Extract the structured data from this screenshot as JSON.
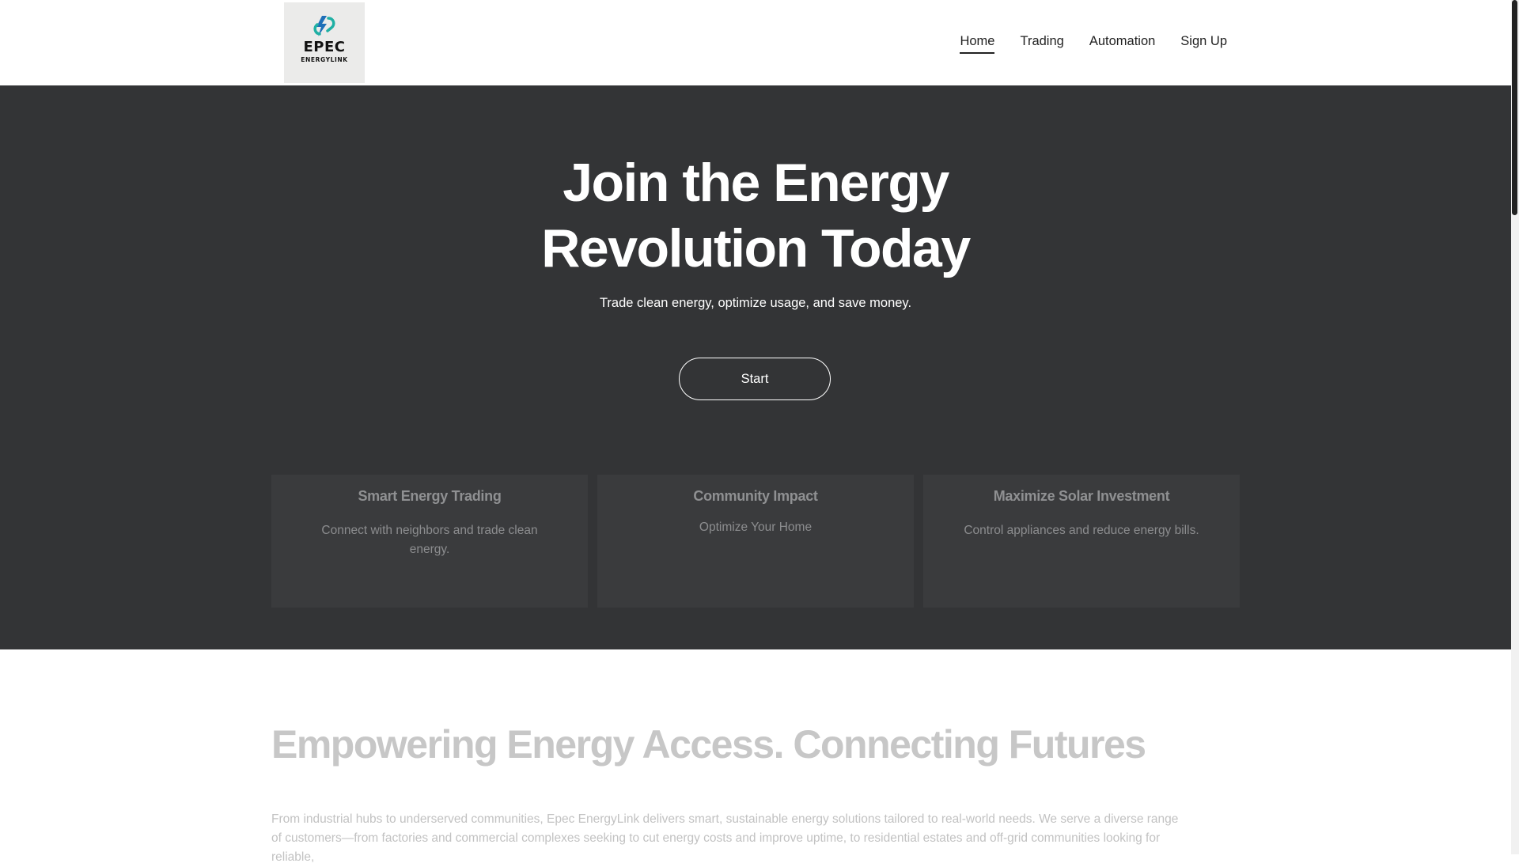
{
  "header": {
    "logo": {
      "brand": "EPEC",
      "sub": "ENERGYLINK",
      "icon": "lightning-link-icon",
      "colors": {
        "blue": "#1f6fb8",
        "teal": "#1fb0a4"
      }
    },
    "nav": [
      {
        "label": "Home",
        "active": true
      },
      {
        "label": "Trading",
        "active": false
      },
      {
        "label": "Automation",
        "active": false
      },
      {
        "label": "Sign Up",
        "active": false
      }
    ]
  },
  "hero": {
    "title_line1": "Join the Energy",
    "title_line2": "Revolution Today",
    "subtitle": "Trade clean energy, optimize usage, and save money.",
    "cta": "Start",
    "background": "#333436"
  },
  "cards": [
    {
      "title": "Smart Energy Trading",
      "text": "Connect with neighbors and trade clean energy."
    },
    {
      "title": "Community Impact",
      "text": "Optimize Your Home"
    },
    {
      "title": "Maximize Solar Investment",
      "text": "Control appliances and reduce energy bills."
    }
  ],
  "about": {
    "title": "Empowering Energy Access. Connecting Futures",
    "text": "From industrial hubs to underserved communities, Epec EnergyLink delivers smart, sustainable energy solutions tailored to real-world needs. We serve a diverse range of customers—from factories and commercial complexes seeking to cut energy costs and improve uptime, to residential estates and off-grid communities looking for reliable,"
  }
}
